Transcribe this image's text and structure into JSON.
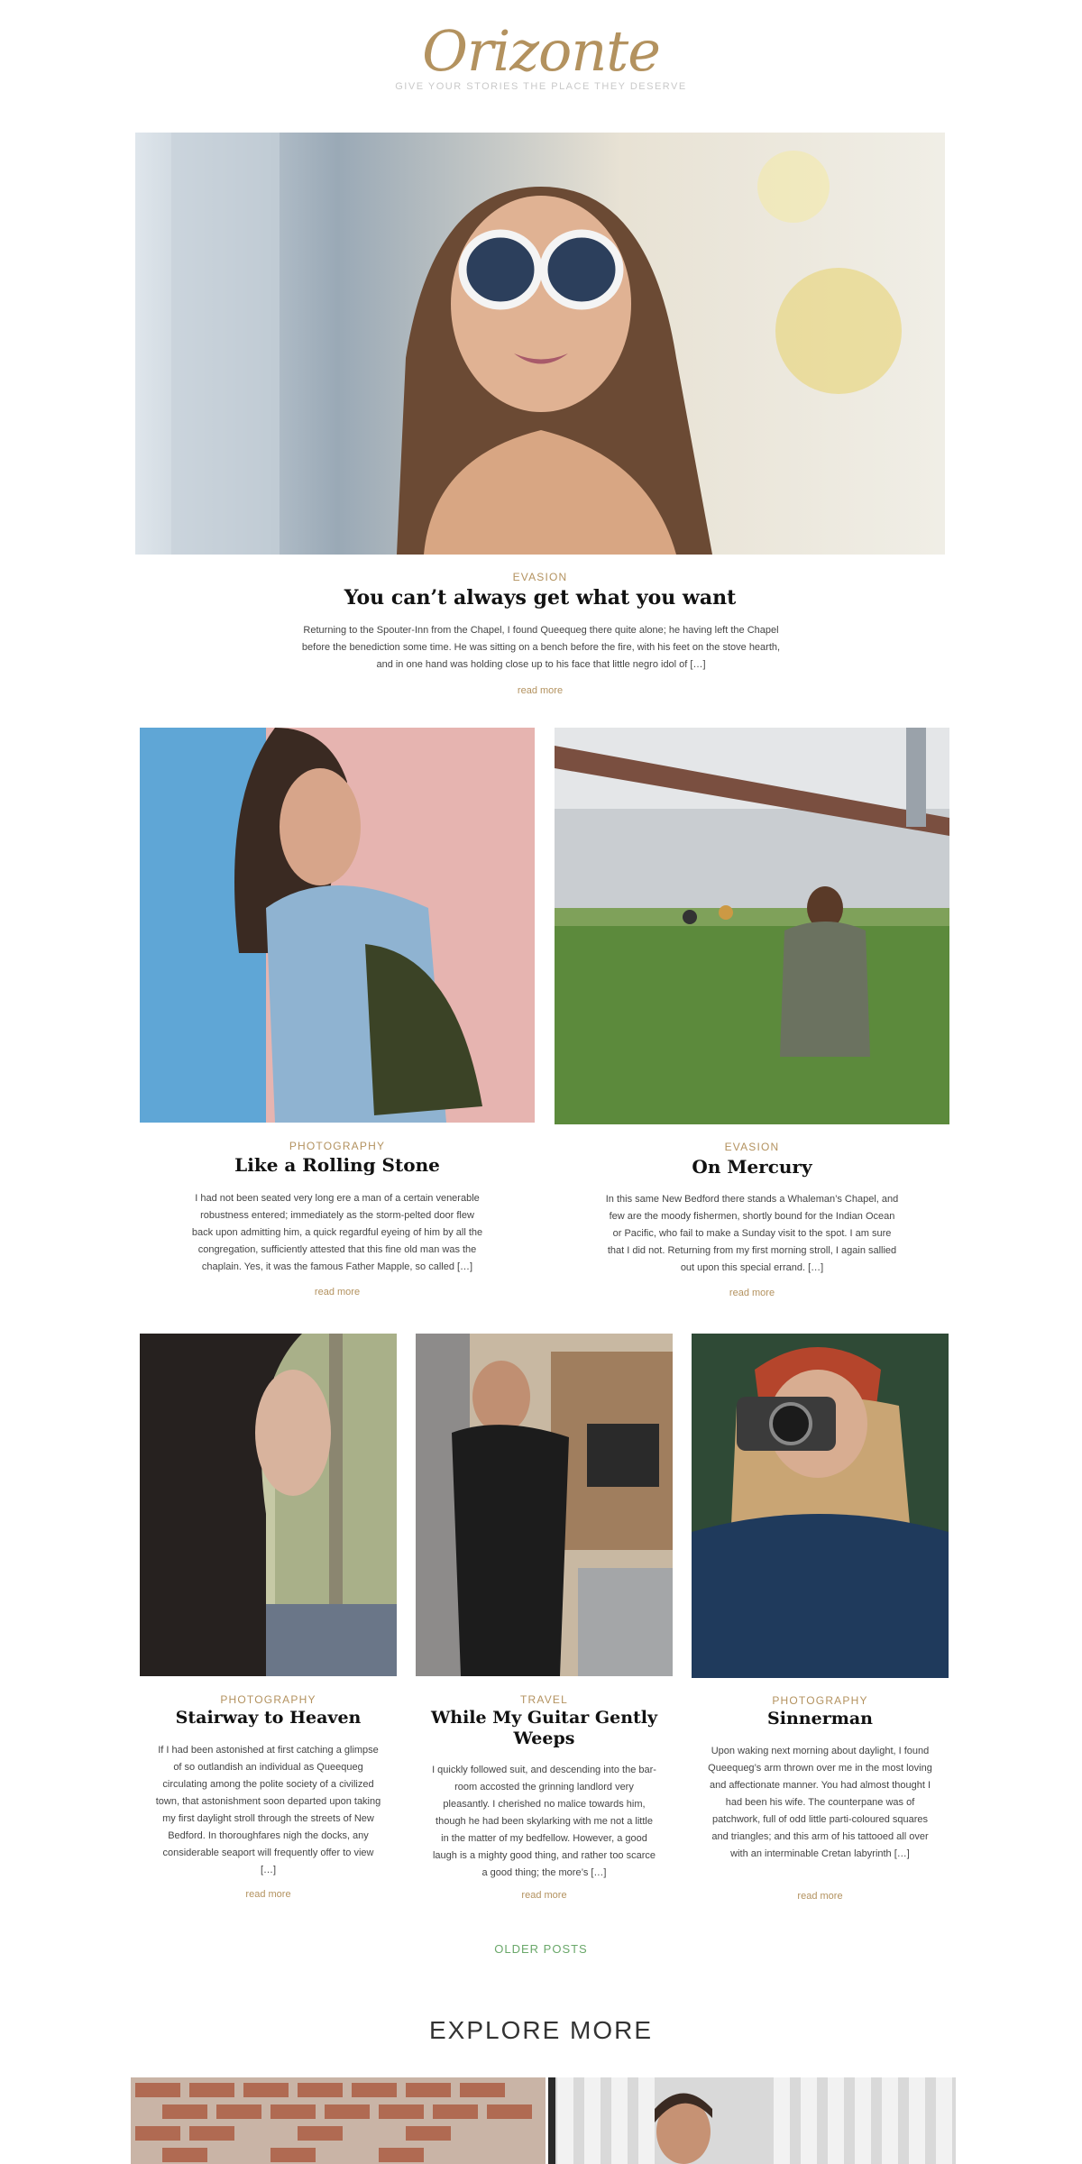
{
  "site": {
    "logo": "Orizonte",
    "tagline": "GIVE YOUR STORIES THE PLACE THEY DESERVE"
  },
  "featured": {
    "category": "EVASION",
    "title": "You can’t always get what you want",
    "excerpt": "Returning to the Spouter-Inn from the Chapel, I found Queequeg there quite alone; he having left the Chapel before the benediction some time. He was sitting on a bench before the fire, with his feet on the stove hearth, and in one hand was holding close up to his face that little negro idol of […]",
    "read_more": "read more"
  },
  "row2": [
    {
      "category": "PHOTOGRAPHY",
      "title": "Like a Rolling Stone",
      "excerpt": "I had not been seated very long ere a man of a certain venerable robustness entered; immediately as the storm-pelted door flew back upon admitting him, a quick regardful eyeing of him by all the congregation, sufficiently attested that this fine old man was the chaplain. Yes, it was the famous Father Mapple, so called […]",
      "read_more": "read more"
    },
    {
      "category": "EVASION",
      "title": "On Mercury",
      "excerpt": "In this same New Bedford there stands a Whaleman’s Chapel, and few are the moody fishermen, shortly bound for the Indian Ocean or Pacific, who fail to make a Sunday visit to the spot. I am sure that I did not. Returning from my first morning stroll, I again sallied out upon this special errand. […]",
      "read_more": "read more"
    }
  ],
  "row3": [
    {
      "category": "PHOTOGRAPHY",
      "title": "Stairway to Heaven",
      "excerpt": "If I had been astonished at first catching a glimpse of so outlandish an individual as Queequeg circulating among the polite society of a civilized town, that astonishment soon departed upon taking my first daylight stroll through the streets of New Bedford. In thoroughfares nigh the docks, any considerable seaport will frequently offer to view […]",
      "read_more": "read more"
    },
    {
      "category": "TRAVEL",
      "title": "While My Guitar Gently Weeps",
      "excerpt": "I quickly followed suit, and descending into the bar-room accosted the grinning landlord very pleasantly. I cherished no malice towards him, though he had been skylarking with me not a little in the matter of my bedfellow. However, a good laugh is a mighty good thing, and rather too scarce a good thing; the more’s […]",
      "read_more": "read more"
    },
    {
      "category": "PHOTOGRAPHY",
      "title": "Sinnerman",
      "excerpt": "Upon waking next morning about daylight, I found Queequeg’s arm thrown over me in the most loving and affectionate manner. You had almost thought I had been his wife. The counterpane was of patchwork, full of odd little parti-coloured squares and triangles; and this arm of his tattooed all over with an interminable Cretan labyrinth […]",
      "read_more": "read more"
    }
  ],
  "pagination": {
    "older": "OLDER POSTS"
  },
  "explore": {
    "title": "EXPLORE MORE"
  },
  "colors": {
    "accent": "#b3925f",
    "older_link": "#6aa86a"
  }
}
